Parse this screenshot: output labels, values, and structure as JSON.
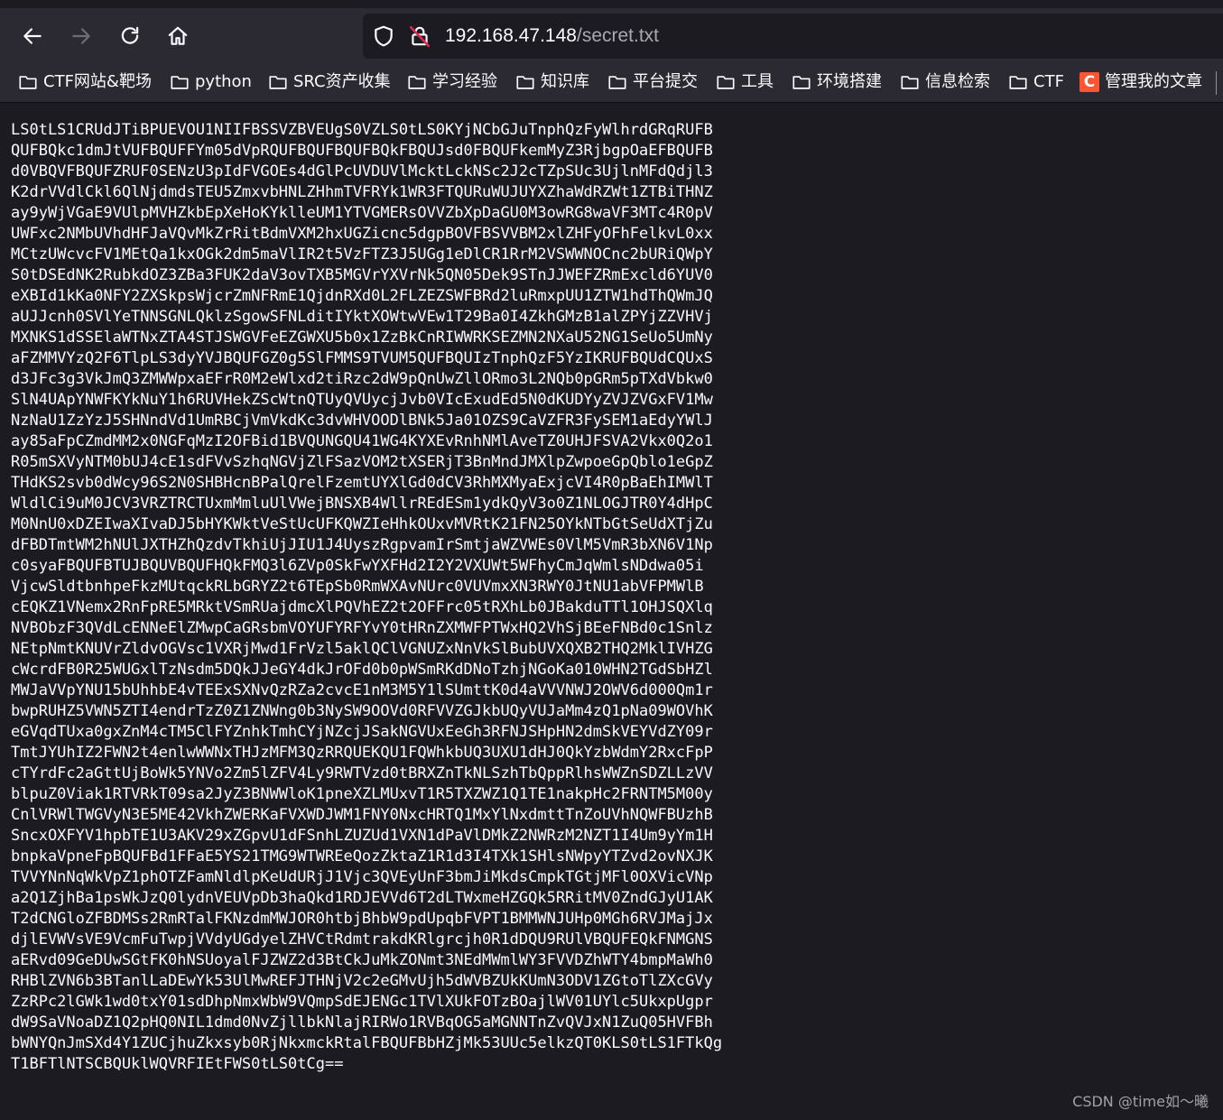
{
  "browser": {
    "url": {
      "host": "192.168.47.148",
      "path": "/secret.txt"
    },
    "icons": {
      "back": "back-arrow-icon",
      "forward": "forward-arrow-icon",
      "reload": "reload-icon",
      "home": "home-icon",
      "tracking_protection": "shield-icon",
      "connection": "insecure-lock-icon"
    }
  },
  "bookmarks": [
    {
      "label": "CTF网站&靶场",
      "icon": "folder-icon"
    },
    {
      "label": "python",
      "icon": "folder-icon"
    },
    {
      "label": "SRC资产收集",
      "icon": "folder-icon"
    },
    {
      "label": "学习经验",
      "icon": "folder-icon"
    },
    {
      "label": "知识库",
      "icon": "folder-icon"
    },
    {
      "label": "平台提交",
      "icon": "folder-icon"
    },
    {
      "label": "工具",
      "icon": "folder-icon"
    },
    {
      "label": "环境搭建",
      "icon": "folder-icon"
    },
    {
      "label": "信息检索",
      "icon": "folder-icon"
    },
    {
      "label": "CTF",
      "icon": "folder-icon"
    },
    {
      "label": "管理我的文章",
      "icon": "csdn-logo-icon",
      "icon_letter": "C",
      "icon_color": "#fc5531"
    }
  ],
  "file": {
    "lines": [
      "LS0tLS1CRUdJTiBPUEVOU1NIIFBSSVZBVEUgS0VZLS0tLS0KYjNCbGJuTnphQzFyWlhrdGRqRUFB",
      "QUFBQkc1dmJtVUFBQUFFYm05dVpRQUFBQUFBQUFBQkFBQUJsd0FBQUFkemMyZ3RjbgpOaEFBQUFB",
      "d0VBQVFBQUFZRUF0SENzU3pIdFVGOEs4dGlPcUVDUVlMcktLckNSc2J2cTZpSUc3UjlnMFdQdjl3",
      "K2drVVdlCkl6QlNjdmdsTEU5ZmxvbHNLZHhmTVFRYk1WR3FTQURuWUJUYXZhaWdRZWt1ZTBiTHNZ",
      "ay9yWjVGaE9VUlpMVHZkbEpXeHoKYklleUM1YTVGMERsOVVZbXpDaGU0M3owRG8waVF3MTc4R0pV",
      "UWFxc2NMbUVhdHFJaVQvMkZrRitBdmVXM2hxUGZicnc5dgpBOVFBSVVBM2xlZHFyOFhFelkvL0xx",
      "MCtzUWcvcFV1MEtQa1kxOGk2dm5maVlIR2t5VzFTZ3J5UGg1eDlCR1RrM2VSWWNOCnc2bURiQWpY",
      "S0tDSEdNK2RubkdOZ3ZBa3FUK2daV3ovTXB5MGVrYXVrNk5QN05Dek9STnJJWEFZRmExcld6YUV0",
      "eXBId1kKa0NFY2ZXSkpsWjcrZmNFRmE1QjdnRXd0L2FLZEZSWFBRd2luRmxpUU1ZTW1hdThQWmJQ",
      "aUJJcnh0SVlYeTNNSGNLQklzSgowSFNLditIYktXOWtwVEw1T29Ba0I4ZkhGMzB1alZPYjZZVHVj",
      "MXNKS1dSSElaWTNxZTA4STJSWGVFeEZGWXU5b0x1ZzBkCnRIWWRKSEZMN2NXaU52NG1SeUo5UmNy",
      "aFZMMVYzQ2F6TlpLS3dyYVJBQUFGZ0g5SlFMMS9TVUM5QUFBQUIzTnphQzF5YzIKRUFBQUdCQUxS",
      "d3JFc3g3VkJmQ3ZMWWpxaEFrR0M2eWlxd2tiRzc2dW9pQnUwZllORmo3L2NQb0pGRm5pTXdVbkw0",
      "SlN4UApYNWFKYkNuY1h6RUVHekZScWtnQTUyQVUycjJvb0VIcExudEd5N0dKUDYyZVJZVGxFV1Mw",
      "NzNaU1ZzYzJ5SHNndVd1UmRBCjVmVkdKc3dvWHVOODlBNk5Ja01OZS9CaVZFR3FySEM1aEdyYWlJ",
      "ay85aFpCZmdMM2x0NGFqMzI2OFBid1BVQUNGQU41WG4KYXEvRnhNMlAveTZ0UHJFSVA2Vkx0Q2o1",
      "R05mSXVyNTM0bUJ4cE1sdFVvSzhqNGVjZlFSazVOM2tXSERjT3BnMndJMXlpZwpoeGpQblo1eGpZ",
      "THdKS2svb0dWcy96S2N0SHBHcnBPalQrelFzemtUYXlGd0dCV3RhMXMyaExjcVI4R0pBaEhIMWlT",
      "WldlCi9uM0JCV3VRZTRCTUxmMmluUlVWejBNSXB4WllrREdESm1ydkQyV3o0Z1NLOGJTR0Y4dHpC",
      "M0NnU0xDZEIwaXIvaDJ5bHYKWktVeStUcUFKQWZIeHhkOUxvMVRtK21FN25OYkNTbGtSeUdXTjZu",
      "dFBDTmtWM2hNUlJXTHZhQzdvTkhiUjJIU1J4UyszRgpvamIrSmtjaWZVWEs0VlM5VmR3bXN6V1Np",
      "c0syaFBQUFBTUJBQUVBQUFHQkFMQ3l6ZVp0SkFwYXFHd2I2Y2VXUWt5WFhyCmJqWmlsNDdwa05i",
      "VjcwSldtbnhpeFkzMUtqckRLbGRYZ2t6TEpSb0RmWXAvNUrc0VUVmxXN3RWY0JtNU1abVFPMWlB",
      "cEQKZ1VNemx2RnFpRE5MRktVSmRUajdmcXlPQVhEZ2t2OFFrc05tRXhLb0JBakduTTl1OHJSQXlq",
      "NVBObzF3QVdLcENNeElZMwpCaGRsbmVOYUFYRFYvY0tHRnZXMWFPTWxHQ2VhSjBEeFNBd0c1Snlz",
      "NEtpNmtKNUVrZldvOGVsc1VXRjMwd1FrVzl5aklQClVGNUZxNnVkSlBubUVXQXB2THQ2MklIVHZG",
      "cWcrdFB0R25WUGxlTzNsdm5DQkJJeGY4dkJrOFd0b0pWSmRKdDNoTzhjNGoKa010WHN2TGdSbHZl",
      "MWJaVVpYNU15bUhhbE4vTEExSXNvQzRZa2cvcE1nM3M5Y1lSUmttK0d4aVVVNWJ2OWV6d000Qm1r",
      "bwpRUHZ5VWN5ZTI4endrTzZ0Z1ZNWng0b3NySW9OOVd0RFVVZGJkbUQyVUJaMm4zQ1pNa09WOVhK",
      "eGVqdTUxa0gxZnM4cTM5ClFYZnhkTmhCYjNZcjJSakNGVUxEeGh3RFNJSHpHN2dmSkVEYVdZY09r",
      "TmtJYUhIZ2FWN2t4enlwWWNxTHJzMFM3QzRRQUEKQU1FQWhkbUQ3UXU1dHJ0QkYzbWdmY2RxcFpP",
      "cTYrdFc2aGttUjBoWk5YNVo2Zm5lZFV4Ly9RWTVzd0tBRXZnTkNLSzhTbQppRlhsWWZnSDZLLzVV",
      "blpuZ0Viak1RTVRkT09sa2JyZ3BNWWloK1pneXZLMUxvT1R5TXZWZ1Q1TE1nakpHc2FRNTM5M00y",
      "CnlVRWlTWGVyN3E5ME42VkhZWERKaFVXWDJWM1FNY0NxcHRTQ1MxYlNxdmttTnZoUVhNQWFBUzhB",
      "SncxOXFYV1hpbTE1U3AKV29xZGpvU1dFSnhLZUZUd1VXN1dPaVlDMkZ2NWRzM2NZT1I4Um9yYm1H",
      "bnpkaVpneFpBQUFBd1FFaE5YS21TMG9WTWREeQozZktaZ1R1d3I4TXk1SHlsNWpyYTZvd2ovNXJK",
      "TVVYNnNqWkVpZ1phOTZFamNldlpKeUdURjJ1Vjc3QVEyUnF3bmJiMkdsCmpkTGtjMFl0OXVicVNp",
      "a2Q1ZjhBa1psWkJzQ0lydnVEUVpDb3haQkd1RDJEVVd6T2dLTWxmeHZGQk5RRitMV0ZndGJyU1AK",
      "T2dCNGloZFBDMSs2RmRTalFKNzdmMWJOR0htbjBhbW9pdUpqbFVPT1BMMWNJUHp0MGh6RVJMajJx",
      "djlEVWVsVE9VcmFuTwpjVVdyUGdyelZHVCtRdmtrakdKRlgrcjh0R1dDQU9RUlVBQUFEQkFNMGNS",
      "aERvd09GeDUwSGtFK0hNSUoyalFJZWZ2d3BtCkJuMkZONmt3NEdMWmlWY3FVVDZhWTY4bmpMaWh0",
      "RHBlZVN6b3BTanlLaDEwYk53UlMwREFJTHNjV2c2eGMvUjh5dWVBZUkKUmN3ODV1ZGtoTlZXcGVy",
      "ZzRPc2lGWk1wd0txY01sdDhpNmxWbW9VQmpSdEJENGc1TVlXUkFOTzBOajlWV01UYlc5UkxpUgpr",
      "dW9SaVNoaDZ1Q2pHQ0NIL1dmd0NvZjllbkNlajRIRWo1RVBqOG5aMGNNTnZvQVJxN1ZuQ05HVFBh",
      "bWNYQnJmSXd4Y1ZUCjhuZkxsyb0RjNkxmckRtalFBQUFBbHZjMk53UUc5elkzQT0KLS0tLS1FTkQg",
      "T1BFTlNTSCBQUklWQVRFIEtFWS0tLS0tCg=="
    ]
  },
  "watermark": "CSDN @time如～曦"
}
